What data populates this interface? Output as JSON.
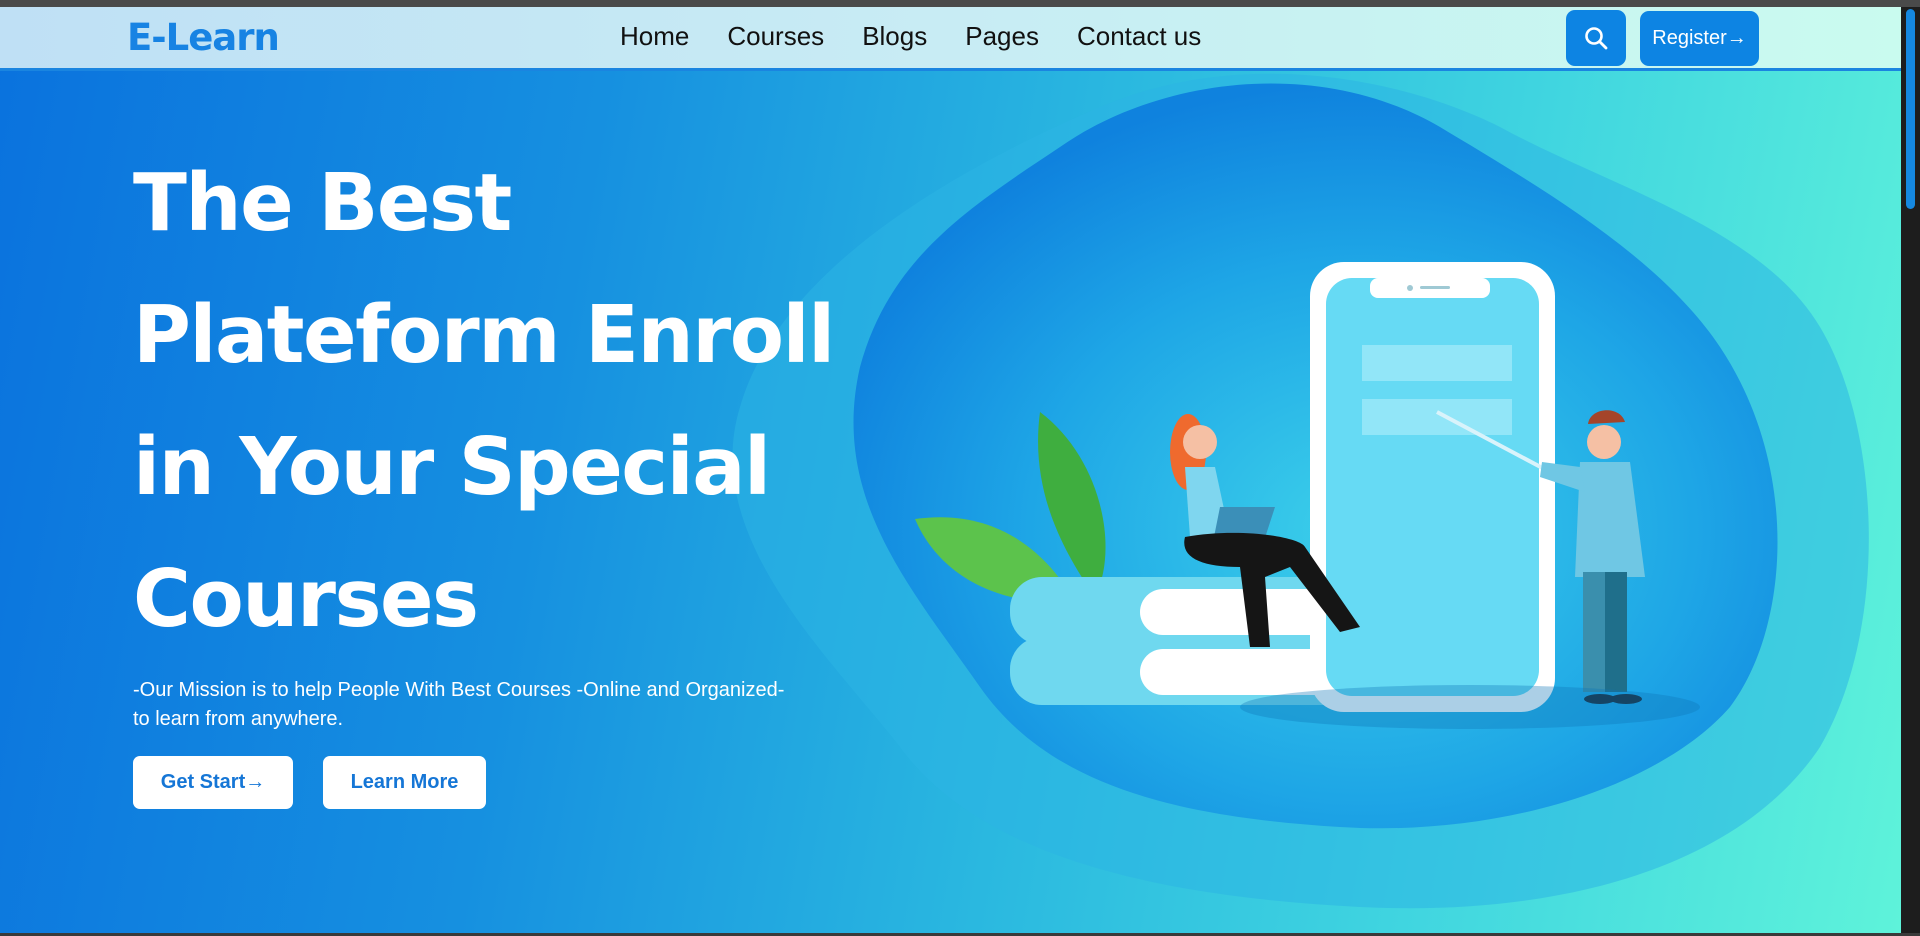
{
  "nav": {
    "logo": "E-Learn",
    "links": [
      "Home",
      "Courses",
      "Blogs",
      "Pages",
      "Contact us"
    ],
    "search_icon": "search-icon",
    "register_label": "Register→"
  },
  "hero": {
    "title_lines": [
      "The Best",
      "Plateform Enroll",
      "in Your Special",
      "Courses"
    ],
    "mission_line1": "-Our Mission is to help People With Best Courses -Online and Organized-",
    "mission_line2": "to learn from anywhere.",
    "get_start_label": "Get Start→",
    "learn_more_label": "Learn More"
  },
  "colors": {
    "primary": "#0d84e3",
    "logo": "#1783e3",
    "hero_start": "#0a72de",
    "hero_end": "#5ef3da"
  }
}
